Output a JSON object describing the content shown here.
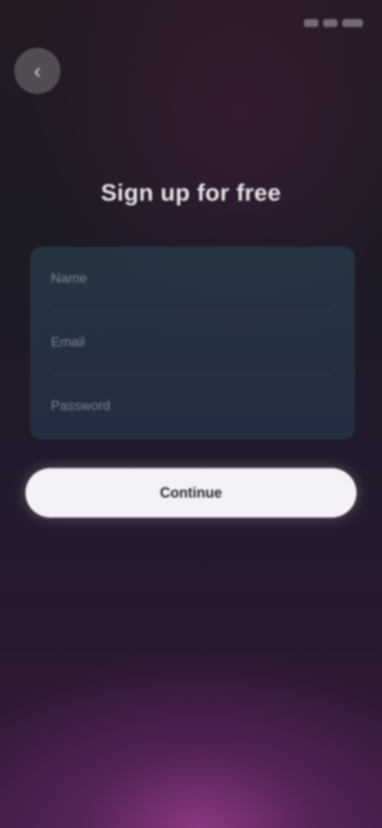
{
  "status_bar": {
    "time": "",
    "icons": [
      "signal-icon",
      "wifi-icon",
      "battery-icon"
    ]
  },
  "navigation": {
    "back_icon": "arrow-left-icon",
    "back_glyph": "‹"
  },
  "page": {
    "title": "Sign up for free"
  },
  "form": {
    "fields": [
      {
        "name": "name",
        "placeholder": "Name"
      },
      {
        "name": "email",
        "placeholder": "Email"
      },
      {
        "name": "password",
        "placeholder": "Password"
      }
    ]
  },
  "actions": {
    "primary_label": "Continue"
  },
  "legal": {
    "text": "",
    "link": ""
  },
  "colors": {
    "background_top": "#241a24",
    "background_bottom_glow": "#963c8c",
    "card": "#283a48",
    "button": "#f4f2f6"
  }
}
